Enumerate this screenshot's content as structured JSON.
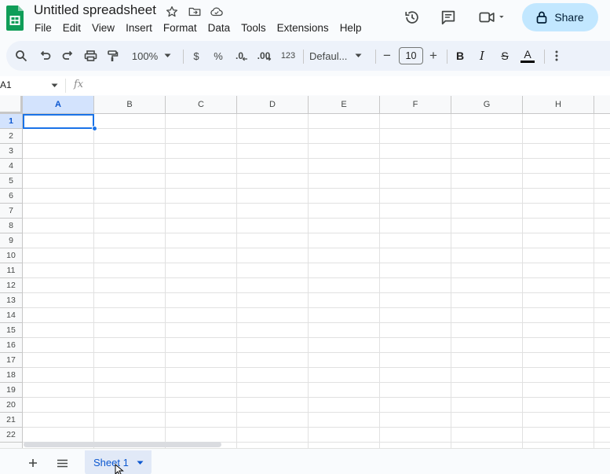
{
  "header": {
    "doc_title": "Untitled spreadsheet",
    "menu": [
      "File",
      "Edit",
      "View",
      "Insert",
      "Format",
      "Data",
      "Tools",
      "Extensions",
      "Help"
    ],
    "share_label": "Share"
  },
  "toolbar": {
    "zoom": "100%",
    "currency": "$",
    "percent": "%",
    "decrease_decimal": ".0",
    "increase_decimal": ".00",
    "number_format": "123",
    "font_family": "Defaul...",
    "font_size": "10",
    "minus": "−",
    "plus": "+",
    "bold": "B",
    "italic": "I",
    "strike": "S",
    "text_color": "A"
  },
  "formula_bar": {
    "cell_ref": "A1",
    "fx": "fx"
  },
  "grid": {
    "columns": [
      "A",
      "B",
      "C",
      "D",
      "E",
      "F",
      "G",
      "H"
    ],
    "rows": [
      "1",
      "2",
      "3",
      "4",
      "5",
      "6",
      "7",
      "8",
      "9",
      "10",
      "11",
      "12",
      "13",
      "14",
      "15",
      "16",
      "17",
      "18",
      "19",
      "20",
      "21",
      "22"
    ],
    "selected_column": "A",
    "selected_row": "1"
  },
  "sheets": {
    "tabs": [
      "Sheet 1"
    ],
    "active": "Sheet 1"
  },
  "colors": {
    "accent": "#0b57d0",
    "share_bg": "#c2e7ff",
    "toolbar_bg": "#edf2fa",
    "selection": "#1a73e8",
    "logo_green": "#0f9d58"
  }
}
